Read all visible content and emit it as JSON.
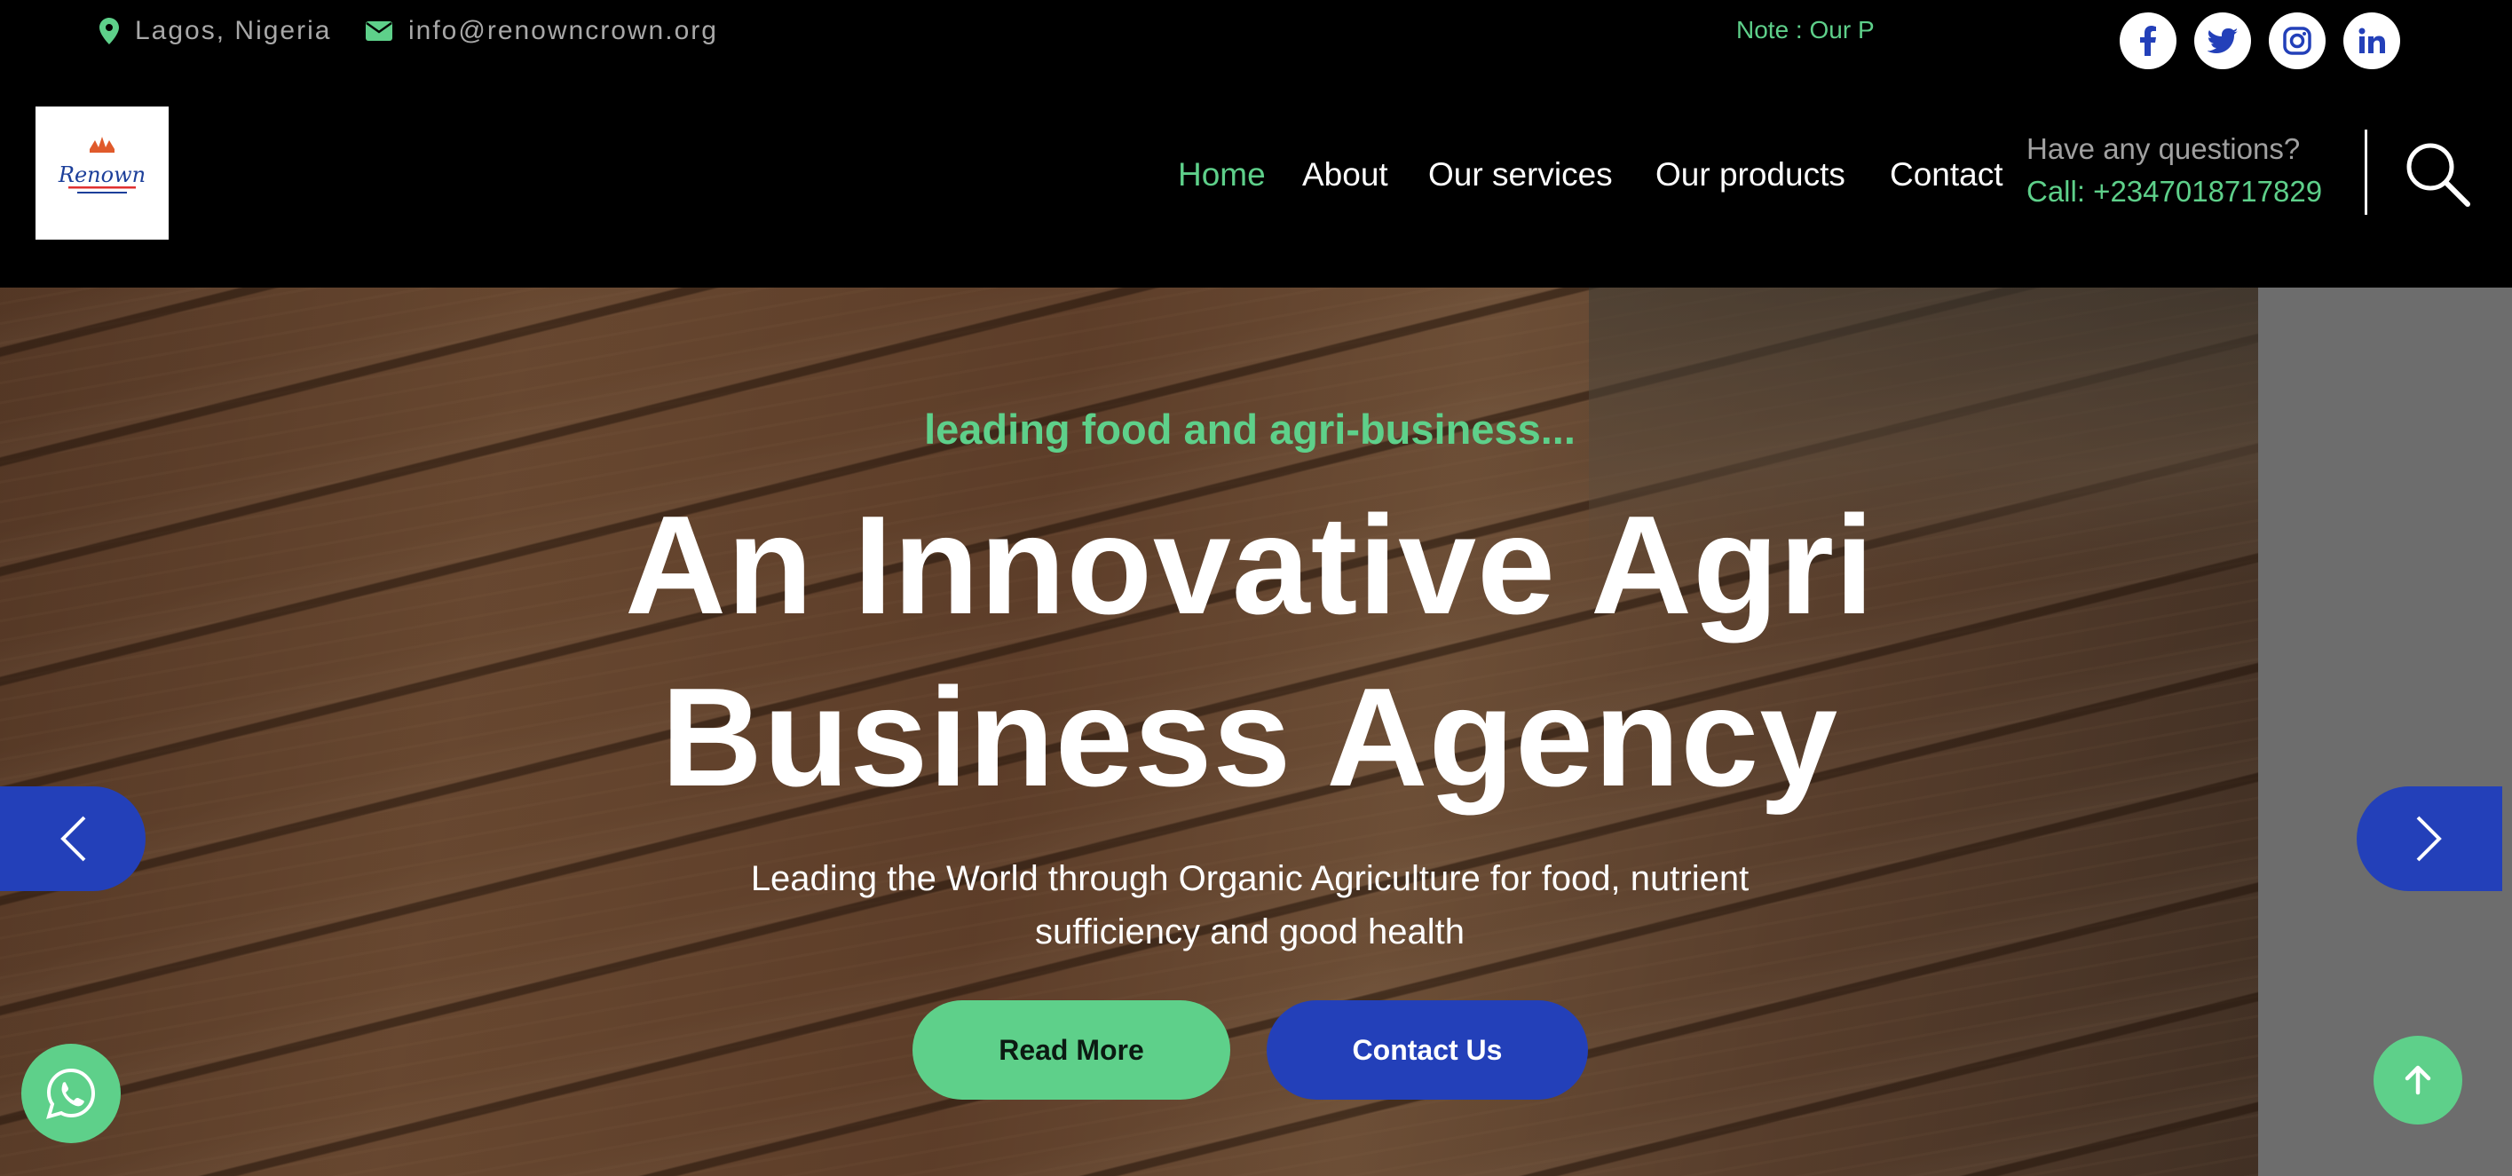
{
  "topbar": {
    "location": "Lagos, Nigeria",
    "email": "info@renowncrown.org",
    "note": "Note : Our P",
    "social": [
      "facebook-icon",
      "twitter-icon",
      "instagram-icon",
      "linkedin-icon"
    ]
  },
  "header": {
    "logo_text": "Renown",
    "nav": [
      "Home",
      "About",
      "Our services",
      "Our products",
      "Contact"
    ],
    "active_nav": "Home",
    "questions": "Have any questions?",
    "phone": "Call: +2347018717829"
  },
  "hero": {
    "tagline": "leading food and agri-business...",
    "title_line1": "An Innovative Agri",
    "title_line2": "Business Agency",
    "subtitle_line1": "Leading the World through Organic Agriculture for food, nutrient",
    "subtitle_line2": "sufficiency and good health",
    "read_more": "Read More",
    "contact_us": "Contact Us"
  },
  "colors": {
    "accent_green": "#5ed08a",
    "brand_blue": "#2340b9",
    "background": "#000000"
  }
}
